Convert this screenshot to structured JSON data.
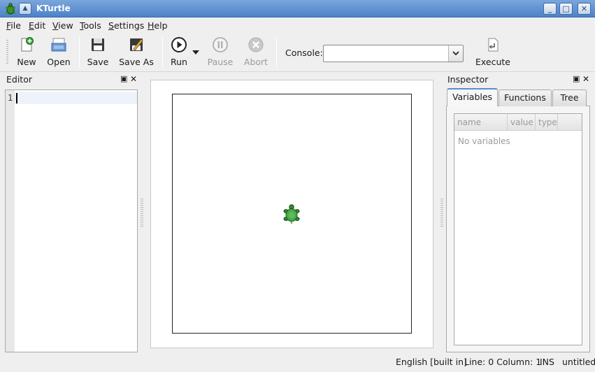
{
  "window": {
    "title": "KTurtle"
  },
  "menubar": [
    {
      "label": "File",
      "mnemonic": "F",
      "rest": "ile"
    },
    {
      "label": "Edit",
      "mnemonic": "E",
      "rest": "dit"
    },
    {
      "label": "View",
      "mnemonic": "V",
      "rest": "iew"
    },
    {
      "label": "Tools",
      "mnemonic": "T",
      "rest": "ools"
    },
    {
      "label": "Settings",
      "mnemonic": "S",
      "rest": "ettings"
    },
    {
      "label": "Help",
      "mnemonic": "H",
      "rest": "elp"
    }
  ],
  "toolbar": {
    "new": {
      "label": "New",
      "icon": "new-file-icon"
    },
    "open": {
      "label": "Open",
      "icon": "open-folder-icon"
    },
    "save": {
      "label": "Save",
      "icon": "floppy-disk-icon"
    },
    "save_as": {
      "label": "Save As",
      "icon": "save-as-icon"
    },
    "run": {
      "label": "Run",
      "icon": "play-icon"
    },
    "pause": {
      "label": "Pause",
      "icon": "pause-icon",
      "enabled": false
    },
    "abort": {
      "label": "Abort",
      "icon": "abort-icon",
      "enabled": false
    },
    "console_label": "Console:",
    "console_value": "",
    "execute": {
      "label": "Execute",
      "icon": "execute-icon"
    }
  },
  "editor": {
    "title": "Editor",
    "line_numbers": [
      "1"
    ],
    "content": ""
  },
  "inspector": {
    "title": "Inspector",
    "tabs": [
      {
        "label": "Variables",
        "active": true
      },
      {
        "label": "Functions",
        "active": false
      },
      {
        "label": "Tree",
        "active": false
      }
    ],
    "columns": [
      "name",
      "value",
      "type"
    ],
    "empty_text": "No variables"
  },
  "statusbar": {
    "language": "English [built in]",
    "position": "Line: 0 Column: 1",
    "mode": "INS",
    "file": "untitled"
  },
  "colors": {
    "titlebar": "#5b8bd0",
    "turtle_green": "#2f8f2f",
    "canvas_border": "#222222"
  }
}
